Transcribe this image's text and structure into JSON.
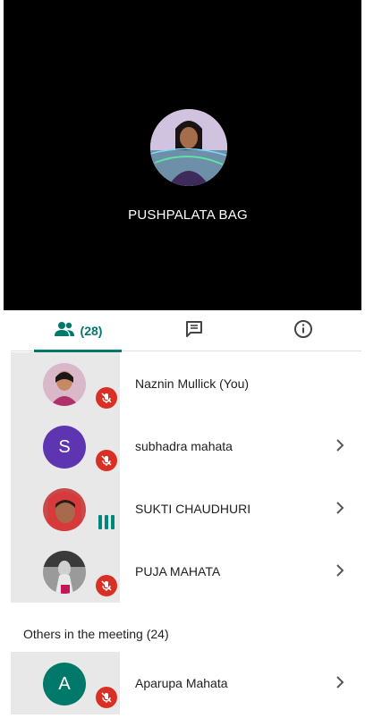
{
  "stage": {
    "speaker_name": "PUSHPALATA BAG"
  },
  "tabs": {
    "people_count": "(28)"
  },
  "participants": [
    {
      "name": "Naznin Mullick (You)",
      "status": "muted",
      "avatar": "photo"
    },
    {
      "name": "subhadra mahata",
      "status": "muted",
      "avatar": "letter",
      "initial": "S",
      "color": "#5e35b1"
    },
    {
      "name": "SUKTI CHAUDHURI",
      "status": "speaking",
      "avatar": "photo"
    },
    {
      "name": "PUJA MAHATA",
      "status": "muted",
      "avatar": "photo"
    }
  ],
  "others": {
    "header": "Others in the meeting (24)",
    "items": [
      {
        "name": "Aparupa Mahata",
        "status": "muted",
        "avatar": "letter",
        "initial": "A",
        "color": "#00796b"
      }
    ]
  },
  "colors": {
    "accent": "#00796b",
    "mute_red": "#d93025",
    "speaking_green": "#00897b"
  },
  "icons": [
    "people-icon",
    "chat-icon",
    "info-icon",
    "mic-off-icon",
    "chevron-right-icon",
    "speaking-indicator-icon"
  ]
}
